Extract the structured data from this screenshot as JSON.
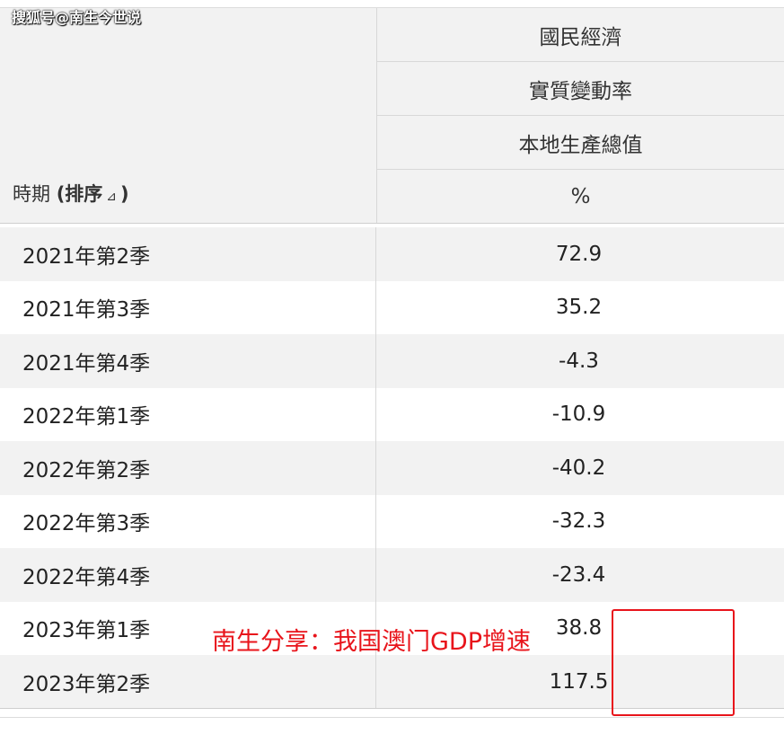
{
  "watermark": "搜狐号@南生今世说",
  "header": {
    "period_label": "時期",
    "sort_label": "(排序",
    "sort_arrow": "⊿",
    "sort_close": ")",
    "levels": [
      "國民經濟",
      "實質變動率",
      "本地生產總值",
      "%"
    ]
  },
  "rows": [
    {
      "period": "2021年第2季",
      "value": "72.9"
    },
    {
      "period": "2021年第3季",
      "value": "35.2"
    },
    {
      "period": "2021年第4季",
      "value": "-4.3"
    },
    {
      "period": "2022年第1季",
      "value": "-10.9"
    },
    {
      "period": "2022年第2季",
      "value": "-40.2"
    },
    {
      "period": "2022年第3季",
      "value": "-32.3"
    },
    {
      "period": "2022年第4季",
      "value": "-23.4"
    },
    {
      "period": "2023年第1季",
      "value": "38.8"
    },
    {
      "period": "2023年第2季",
      "value": "117.5"
    }
  ],
  "annotation": "南生分享：我国澳门GDP增速",
  "colors": {
    "annotation": "#e8141b",
    "row_stripe": "#f2f2f2"
  }
}
